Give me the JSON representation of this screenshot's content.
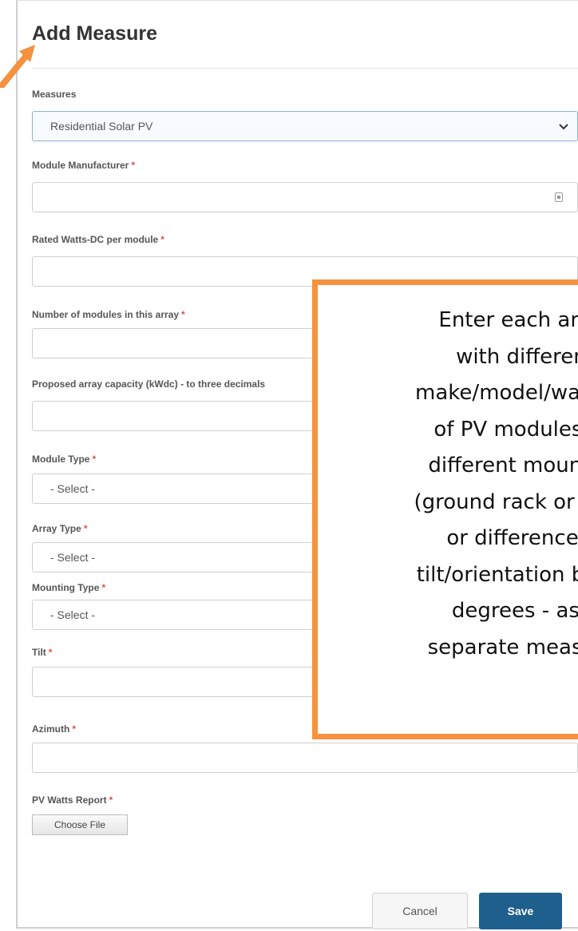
{
  "dialog": {
    "title": "Add Measure"
  },
  "fields": {
    "measures": {
      "label": "Measures",
      "value": "Residential Solar PV"
    },
    "module_manufacturer": {
      "label": "Module Manufacturer",
      "value": ""
    },
    "rated_watts": {
      "label": "Rated Watts-DC per module",
      "value": ""
    },
    "num_modules": {
      "label": "Number of modules in this array",
      "value": ""
    },
    "array_capacity": {
      "label": "Proposed array capacity (kWdc) - to three decimals",
      "value": ""
    },
    "module_type": {
      "label": "Module Type",
      "value": "- Select -"
    },
    "array_type": {
      "label": "Array Type",
      "value": "- Select -"
    },
    "mounting_type": {
      "label": "Mounting Type",
      "value": "- Select -"
    },
    "tilt": {
      "label": "Tilt",
      "value": ""
    },
    "azimuth": {
      "label": "Azimuth",
      "value": ""
    },
    "pv_watts_report": {
      "label": "PV Watts Report",
      "button": "Choose File"
    }
  },
  "required_marker": "*",
  "actions": {
    "cancel_label": "Cancel",
    "save_label": "Save"
  },
  "callout": {
    "text": "Enter each array\nwith different\nmake/model/wattage\nof PV modules, or\ndifferent mounting\n(ground rack or roof),\nor difference in\ntilt/orientation by 5+\ndegrees - as a\nseparate measure."
  },
  "colors": {
    "callout_border": "#f4923f",
    "save_button": "#1f5f8e",
    "required": "#d9534f"
  },
  "icons": {
    "select_chevron": "chevron-down-icon",
    "calculator": "calculator-icon",
    "pointer_arrow": "arrow-icon"
  }
}
